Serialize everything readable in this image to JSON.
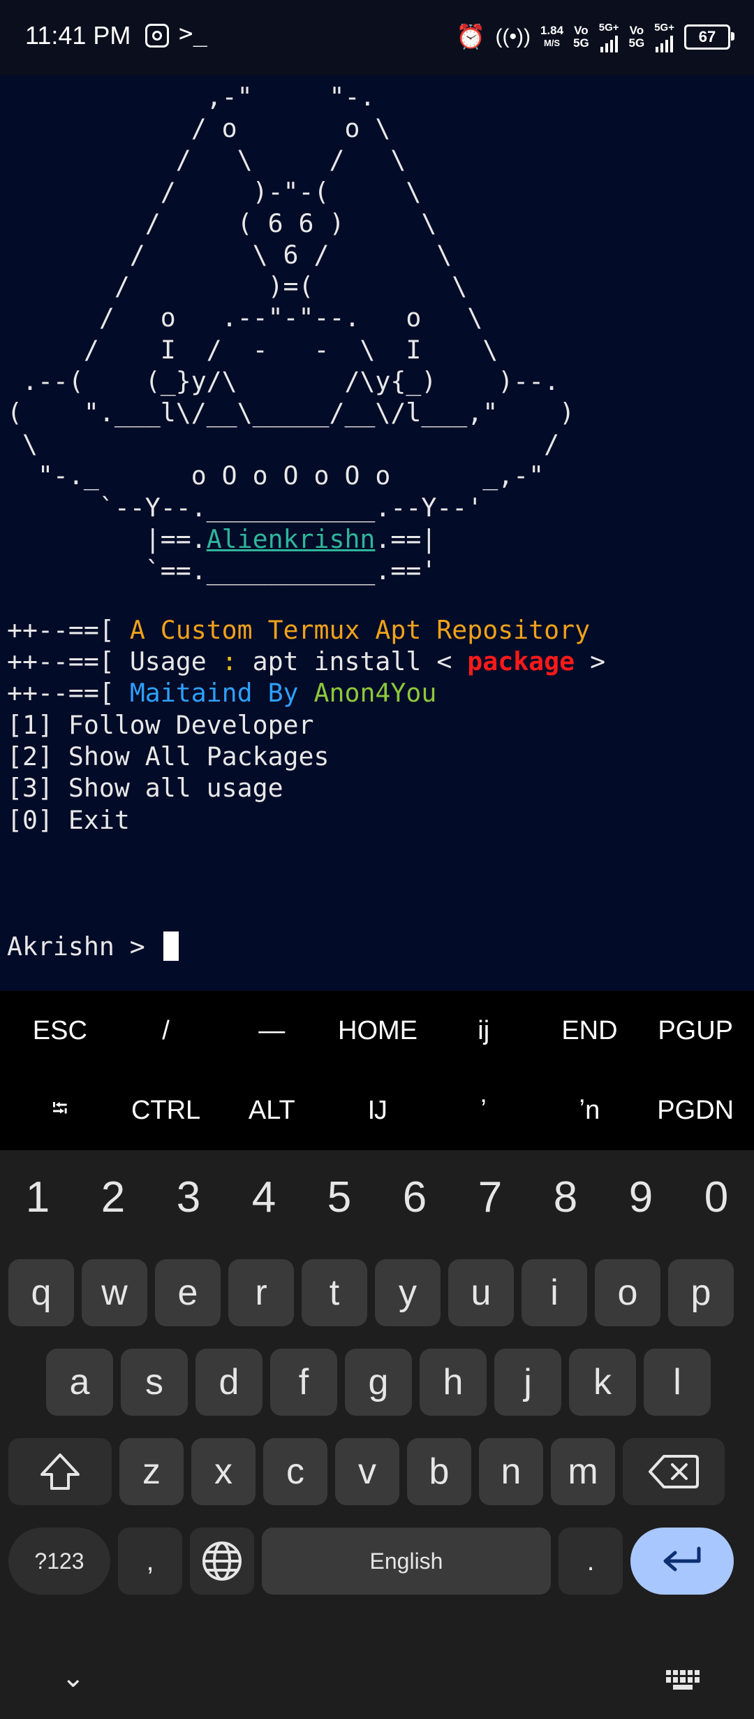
{
  "status_bar": {
    "time": "11:41 PM",
    "speed_value": "1.84",
    "speed_unit": "M/S",
    "sim1": "Vo\n5G",
    "sim1_net": "5G+",
    "sim2": "Vo\n5G",
    "sim2_net": "5G+",
    "battery": "67"
  },
  "terminal": {
    "ascii_top": "             ,-\"     \"-.\n            / o       o \\\n           /   \\     /   \\\n          /     )-\"-(     \\\n         /     ( 6 6 )     \\\n        /       \\ 6 /       \\\n       /         )=(         \\\n      /   o   .--\"-\"--.   o   \\\n     /    I  /  -   -  \\  I    \\\n .--(    (_}y/\\       /\\y{_)    )--.\n(    \".___l\\/__\\_____/__\\/l___,\"    )\n \\                                 /\n  \"-._      o O o O o O o      _,-\"\n      `--Y--.___________.--Y--'\n         |==.",
    "logo_name": "Alienkrishn",
    "ascii_bottom": ".==|\n         `==.___________.=='",
    "line1_prefix": "++--==[ ",
    "line1_text": "A Custom Termux Apt Repository",
    "line2_prefix": "++--==[ ",
    "line2_usage": "Usage ",
    "line2_colon": ":",
    "line2_cmd": " apt install < ",
    "line2_pkg": "package",
    "line2_end": " >",
    "line3_prefix": "++--==[ ",
    "line3_by": "Maitaind By ",
    "line3_name": "Anon4You",
    "menu": [
      "[1] Follow Developer",
      "[2] Show All Packages",
      "[3] Show all usage",
      "[0] Exit"
    ],
    "prompt": "Akrishn > "
  },
  "extra_keys": {
    "row1": [
      "ESC",
      "/",
      "―",
      "HOME",
      "ij",
      "END",
      "PGUP"
    ],
    "row2": [
      "⭾",
      "CTRL",
      "ALT",
      "Ĳ",
      "ʼ",
      "ʼn",
      "PGDN"
    ]
  },
  "keyboard": {
    "numbers": [
      "1",
      "2",
      "3",
      "4",
      "5",
      "6",
      "7",
      "8",
      "9",
      "0"
    ],
    "row1": [
      "q",
      "w",
      "e",
      "r",
      "t",
      "y",
      "u",
      "i",
      "o",
      "p"
    ],
    "row2": [
      "a",
      "s",
      "d",
      "f",
      "g",
      "h",
      "j",
      "k",
      "l"
    ],
    "row3": [
      "z",
      "x",
      "c",
      "v",
      "b",
      "n",
      "m"
    ],
    "sym_label": "?123",
    "comma": ",",
    "space_label": "English",
    "period": ".",
    "shift_icon": "shift-icon",
    "backspace_icon": "backspace-icon",
    "globe_icon": "globe-icon",
    "enter_icon": "enter-icon",
    "enter_color": "#a9c7ff"
  }
}
